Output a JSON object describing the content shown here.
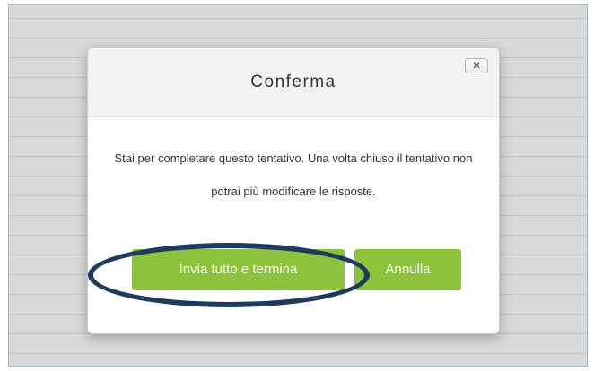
{
  "dialog": {
    "title": "Conferma",
    "close_label": "✕",
    "message": "Stai per completare questo tentativo. Una volta chiuso il tentativo non potrai più modificare le risposte.",
    "submit_label": "Invia tutto e termina",
    "cancel_label": "Annulla"
  },
  "colors": {
    "button_green": "#8cc23c",
    "highlight_ring": "#1e3a5f",
    "backdrop": "#d9d9d9"
  }
}
